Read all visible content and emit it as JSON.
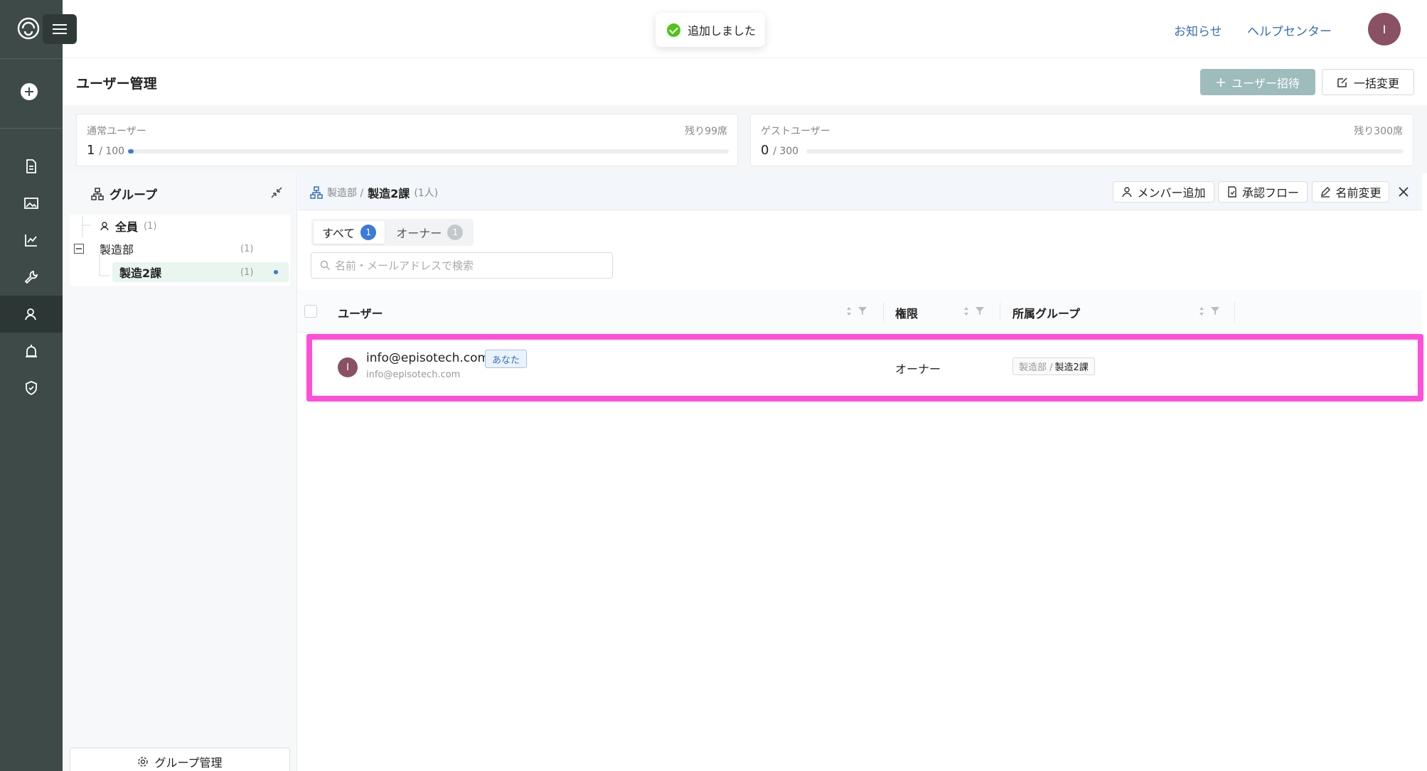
{
  "header": {
    "toast": "追加しました",
    "links": [
      "お知らせ",
      "ヘルプセンター"
    ],
    "avatar_initial": "I"
  },
  "page": {
    "title": "ユーザー管理",
    "invite_button": "ユーザー招待",
    "bulk_button": "一括変更"
  },
  "quota": {
    "regular": {
      "label": "通常ユーザー",
      "used": "1",
      "total": "/ 100",
      "remaining": "残り99席",
      "fill_fraction": 0.01
    },
    "guest": {
      "label": "ゲストユーザー",
      "used": "0",
      "total": "/ 300",
      "remaining": "残り300席",
      "fill_fraction": 0
    }
  },
  "groups": {
    "title": "グループ",
    "tree": [
      {
        "label": "全員",
        "count": "(1)"
      },
      {
        "label": "製造部",
        "count": "(1)"
      },
      {
        "label": "製造2課",
        "count": "(1)",
        "selected": true
      }
    ],
    "manage_button": "グループ管理"
  },
  "main": {
    "breadcrumb_parent": "製造部 /",
    "breadcrumb_current": "製造2課",
    "breadcrumb_count": "(1人)",
    "actions": [
      "メンバー追加",
      "承認フロー",
      "名前変更"
    ],
    "tabs": [
      {
        "label": "すべて",
        "count": "1"
      },
      {
        "label": "オーナー",
        "count": "1"
      }
    ],
    "search_placeholder": "名前・メールアドレスで検索",
    "columns": [
      "ユーザー",
      "権限",
      "所属グループ"
    ],
    "rows": [
      {
        "initial": "I",
        "email": "info@episotech.com",
        "sub_email": "info@episotech.com",
        "you_tag": "あなた",
        "role": "オーナー",
        "group_parent": "製造部 /",
        "group_child": "製造2課"
      }
    ]
  },
  "colors": {
    "rail": "#3d4a48",
    "accent_blue": "#3b7ad9",
    "highlight": "#ff4fd8",
    "invite_button": "#9fbcbc",
    "avatar": "#8a5064"
  }
}
